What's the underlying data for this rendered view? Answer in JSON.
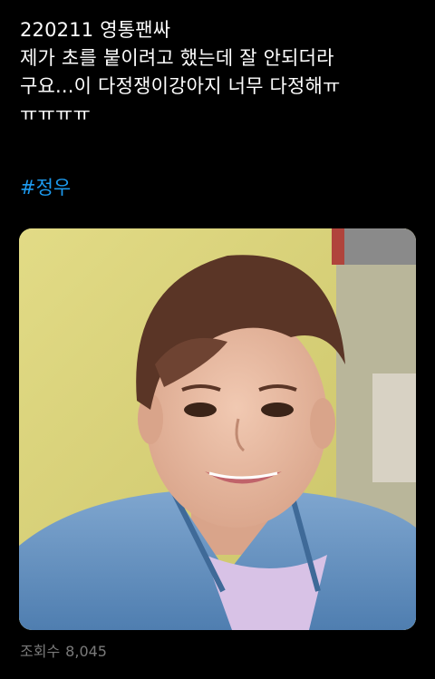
{
  "tweet": {
    "lines": [
      "220211 영통팬싸",
      "제가 초를 붙이려고 했는데 잘 안되더라",
      "구요...이 다정쟁이강아지 너무 다정해ㅠ",
      "ㅠㅠㅠㅠ"
    ],
    "hashtag": "#정우"
  },
  "stats": {
    "views_label": "조회수",
    "views_count": "8,045"
  },
  "colors": {
    "background": "#000000",
    "text": "#ffffff",
    "link": "#1d9bf0",
    "muted": "#7a7a7a"
  }
}
